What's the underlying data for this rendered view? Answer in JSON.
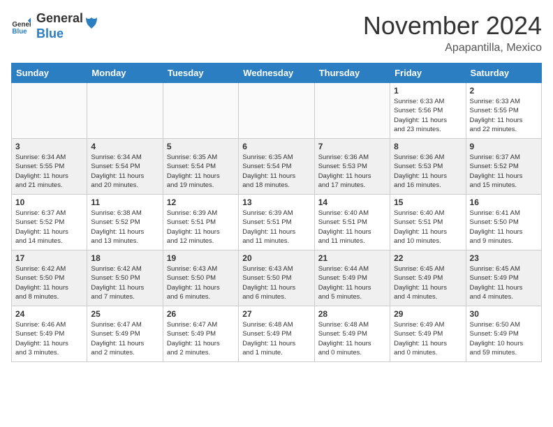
{
  "header": {
    "logo_line1": "General",
    "logo_line2": "Blue",
    "month_title": "November 2024",
    "location": "Apapantilla, Mexico"
  },
  "weekdays": [
    "Sunday",
    "Monday",
    "Tuesday",
    "Wednesday",
    "Thursday",
    "Friday",
    "Saturday"
  ],
  "weeks": [
    [
      {
        "day": "",
        "info": ""
      },
      {
        "day": "",
        "info": ""
      },
      {
        "day": "",
        "info": ""
      },
      {
        "day": "",
        "info": ""
      },
      {
        "day": "",
        "info": ""
      },
      {
        "day": "1",
        "info": "Sunrise: 6:33 AM\nSunset: 5:56 PM\nDaylight: 11 hours\nand 23 minutes."
      },
      {
        "day": "2",
        "info": "Sunrise: 6:33 AM\nSunset: 5:55 PM\nDaylight: 11 hours\nand 22 minutes."
      }
    ],
    [
      {
        "day": "3",
        "info": "Sunrise: 6:34 AM\nSunset: 5:55 PM\nDaylight: 11 hours\nand 21 minutes."
      },
      {
        "day": "4",
        "info": "Sunrise: 6:34 AM\nSunset: 5:54 PM\nDaylight: 11 hours\nand 20 minutes."
      },
      {
        "day": "5",
        "info": "Sunrise: 6:35 AM\nSunset: 5:54 PM\nDaylight: 11 hours\nand 19 minutes."
      },
      {
        "day": "6",
        "info": "Sunrise: 6:35 AM\nSunset: 5:54 PM\nDaylight: 11 hours\nand 18 minutes."
      },
      {
        "day": "7",
        "info": "Sunrise: 6:36 AM\nSunset: 5:53 PM\nDaylight: 11 hours\nand 17 minutes."
      },
      {
        "day": "8",
        "info": "Sunrise: 6:36 AM\nSunset: 5:53 PM\nDaylight: 11 hours\nand 16 minutes."
      },
      {
        "day": "9",
        "info": "Sunrise: 6:37 AM\nSunset: 5:52 PM\nDaylight: 11 hours\nand 15 minutes."
      }
    ],
    [
      {
        "day": "10",
        "info": "Sunrise: 6:37 AM\nSunset: 5:52 PM\nDaylight: 11 hours\nand 14 minutes."
      },
      {
        "day": "11",
        "info": "Sunrise: 6:38 AM\nSunset: 5:52 PM\nDaylight: 11 hours\nand 13 minutes."
      },
      {
        "day": "12",
        "info": "Sunrise: 6:39 AM\nSunset: 5:51 PM\nDaylight: 11 hours\nand 12 minutes."
      },
      {
        "day": "13",
        "info": "Sunrise: 6:39 AM\nSunset: 5:51 PM\nDaylight: 11 hours\nand 11 minutes."
      },
      {
        "day": "14",
        "info": "Sunrise: 6:40 AM\nSunset: 5:51 PM\nDaylight: 11 hours\nand 11 minutes."
      },
      {
        "day": "15",
        "info": "Sunrise: 6:40 AM\nSunset: 5:51 PM\nDaylight: 11 hours\nand 10 minutes."
      },
      {
        "day": "16",
        "info": "Sunrise: 6:41 AM\nSunset: 5:50 PM\nDaylight: 11 hours\nand 9 minutes."
      }
    ],
    [
      {
        "day": "17",
        "info": "Sunrise: 6:42 AM\nSunset: 5:50 PM\nDaylight: 11 hours\nand 8 minutes."
      },
      {
        "day": "18",
        "info": "Sunrise: 6:42 AM\nSunset: 5:50 PM\nDaylight: 11 hours\nand 7 minutes."
      },
      {
        "day": "19",
        "info": "Sunrise: 6:43 AM\nSunset: 5:50 PM\nDaylight: 11 hours\nand 6 minutes."
      },
      {
        "day": "20",
        "info": "Sunrise: 6:43 AM\nSunset: 5:50 PM\nDaylight: 11 hours\nand 6 minutes."
      },
      {
        "day": "21",
        "info": "Sunrise: 6:44 AM\nSunset: 5:49 PM\nDaylight: 11 hours\nand 5 minutes."
      },
      {
        "day": "22",
        "info": "Sunrise: 6:45 AM\nSunset: 5:49 PM\nDaylight: 11 hours\nand 4 minutes."
      },
      {
        "day": "23",
        "info": "Sunrise: 6:45 AM\nSunset: 5:49 PM\nDaylight: 11 hours\nand 4 minutes."
      }
    ],
    [
      {
        "day": "24",
        "info": "Sunrise: 6:46 AM\nSunset: 5:49 PM\nDaylight: 11 hours\nand 3 minutes."
      },
      {
        "day": "25",
        "info": "Sunrise: 6:47 AM\nSunset: 5:49 PM\nDaylight: 11 hours\nand 2 minutes."
      },
      {
        "day": "26",
        "info": "Sunrise: 6:47 AM\nSunset: 5:49 PM\nDaylight: 11 hours\nand 2 minutes."
      },
      {
        "day": "27",
        "info": "Sunrise: 6:48 AM\nSunset: 5:49 PM\nDaylight: 11 hours\nand 1 minute."
      },
      {
        "day": "28",
        "info": "Sunrise: 6:48 AM\nSunset: 5:49 PM\nDaylight: 11 hours\nand 0 minutes."
      },
      {
        "day": "29",
        "info": "Sunrise: 6:49 AM\nSunset: 5:49 PM\nDaylight: 11 hours\nand 0 minutes."
      },
      {
        "day": "30",
        "info": "Sunrise: 6:50 AM\nSunset: 5:49 PM\nDaylight: 10 hours\nand 59 minutes."
      }
    ]
  ]
}
